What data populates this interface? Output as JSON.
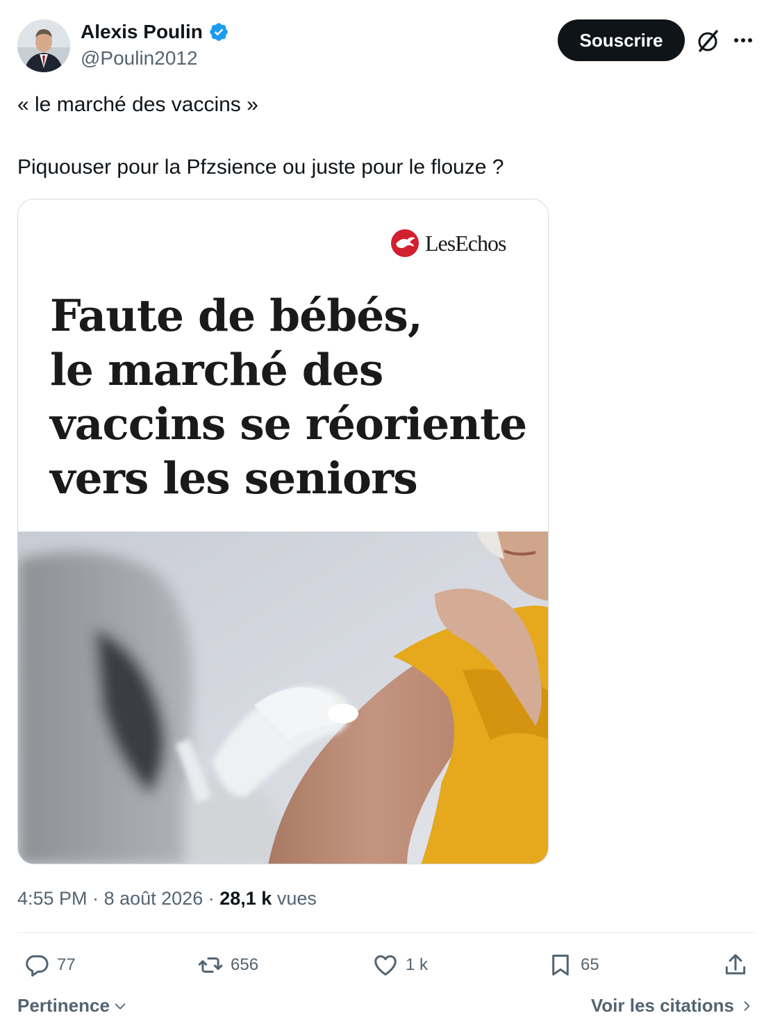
{
  "author": {
    "name": "Alexis Poulin",
    "handle": "@Poulin2012"
  },
  "header": {
    "subscribe_label": "Souscrire"
  },
  "post": {
    "line1": "« le marché des vaccins »",
    "line2": "Piquouser pour la Pfzsience ou juste pour le flouze ?"
  },
  "media": {
    "publisher": "LesEchos",
    "headline_lines": [
      "Faute de bébés,",
      "le marché des",
      "vaccins se réoriente",
      "vers les seniors"
    ]
  },
  "meta": {
    "time": "4:55 PM",
    "date": "8 août 2026",
    "views_count": "28,1 k",
    "views_label": "vues"
  },
  "actions": {
    "replies": "77",
    "reposts": "656",
    "likes": "1 k",
    "bookmarks": "65"
  },
  "footer": {
    "sort_label": "Pertinence",
    "quotes_label": "Voir les citations"
  },
  "colors": {
    "accent_blue": "#1d9bf0",
    "text_primary": "#0f1419",
    "text_secondary": "#536471",
    "les_echos_red": "#d1202e",
    "sweater_yellow": "#e6a81c"
  }
}
